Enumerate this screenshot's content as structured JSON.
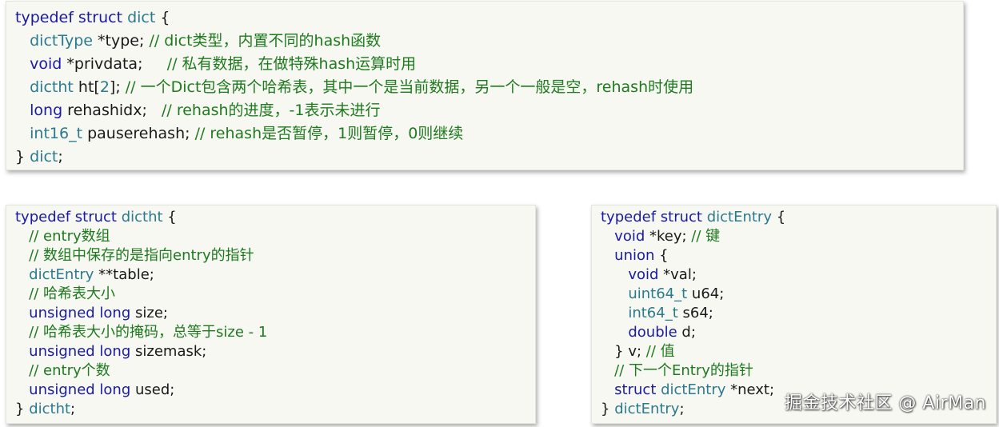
{
  "dict": {
    "lines": [
      [
        [
          "kw",
          "typedef struct "
        ],
        [
          "ty",
          "dict"
        ],
        [
          "id",
          " {"
        ]
      ],
      [
        [
          "id",
          "   "
        ],
        [
          "ty",
          "dictType"
        ],
        [
          "id",
          " *type; "
        ],
        [
          "cm",
          "// dict类型，内置不同的hash函数"
        ]
      ],
      [
        [
          "id",
          "   "
        ],
        [
          "kw",
          "void"
        ],
        [
          "id",
          " *privdata;     "
        ],
        [
          "cm",
          "// 私有数据，在做特殊hash运算时用"
        ]
      ],
      [
        [
          "id",
          "   "
        ],
        [
          "ty",
          "dictht"
        ],
        [
          "id",
          " ht["
        ],
        [
          "ty",
          "2"
        ],
        [
          "id",
          "]; "
        ],
        [
          "cm",
          "// 一个Dict包含两个哈希表，其中一个是当前数据，另一个一般是空，rehash时使用"
        ]
      ],
      [
        [
          "id",
          "   "
        ],
        [
          "kw",
          "long"
        ],
        [
          "id",
          " rehashidx;   "
        ],
        [
          "cm",
          "// rehash的进度，-1表示未进行"
        ]
      ],
      [
        [
          "id",
          "   "
        ],
        [
          "ty",
          "int16_t"
        ],
        [
          "id",
          " pauserehash; "
        ],
        [
          "cm",
          "// rehash是否暂停，1则暂停，0则继续"
        ]
      ],
      [
        [
          "id",
          "} "
        ],
        [
          "ty",
          "dict"
        ],
        [
          "id",
          ";"
        ]
      ]
    ]
  },
  "dictht": {
    "lines": [
      [
        [
          "kw",
          "typedef struct "
        ],
        [
          "ty",
          "dictht"
        ],
        [
          "id",
          " {"
        ]
      ],
      [
        [
          "id",
          "   "
        ],
        [
          "cm",
          "// entry数组"
        ]
      ],
      [
        [
          "id",
          "   "
        ],
        [
          "cm",
          "// 数组中保存的是指向entry的指针"
        ]
      ],
      [
        [
          "id",
          "   "
        ],
        [
          "ty",
          "dictEntry"
        ],
        [
          "id",
          " **table;"
        ]
      ],
      [
        [
          "id",
          "   "
        ],
        [
          "cm",
          "// 哈希表大小"
        ]
      ],
      [
        [
          "id",
          "   "
        ],
        [
          "kw",
          "unsigned long"
        ],
        [
          "id",
          " size;"
        ]
      ],
      [
        [
          "id",
          "   "
        ],
        [
          "cm",
          "// 哈希表大小的掩码，总等于size - 1"
        ]
      ],
      [
        [
          "id",
          "   "
        ],
        [
          "kw",
          "unsigned long"
        ],
        [
          "id",
          " sizemask;"
        ]
      ],
      [
        [
          "id",
          "   "
        ],
        [
          "cm",
          "// entry个数"
        ]
      ],
      [
        [
          "id",
          "   "
        ],
        [
          "kw",
          "unsigned long"
        ],
        [
          "id",
          " used;"
        ]
      ],
      [
        [
          "id",
          "} "
        ],
        [
          "ty",
          "dictht"
        ],
        [
          "id",
          ";"
        ]
      ]
    ]
  },
  "dictEntry": {
    "lines": [
      [
        [
          "kw",
          "typedef struct "
        ],
        [
          "ty",
          "dictEntry"
        ],
        [
          "id",
          " {"
        ]
      ],
      [
        [
          "id",
          "   "
        ],
        [
          "kw",
          "void"
        ],
        [
          "id",
          " *key; "
        ],
        [
          "cm",
          "// 键"
        ]
      ],
      [
        [
          "id",
          "   "
        ],
        [
          "kw",
          "union"
        ],
        [
          "id",
          " {"
        ]
      ],
      [
        [
          "id",
          "      "
        ],
        [
          "kw",
          "void"
        ],
        [
          "id",
          " *val;"
        ]
      ],
      [
        [
          "id",
          "      "
        ],
        [
          "ty",
          "uint64_t"
        ],
        [
          "id",
          " u64;"
        ]
      ],
      [
        [
          "id",
          "      "
        ],
        [
          "ty",
          "int64_t"
        ],
        [
          "id",
          " s64;"
        ]
      ],
      [
        [
          "id",
          "      "
        ],
        [
          "kw",
          "double"
        ],
        [
          "id",
          " d;"
        ]
      ],
      [
        [
          "id",
          "   } v; "
        ],
        [
          "cm",
          "// 值"
        ]
      ],
      [
        [
          "id",
          "   "
        ],
        [
          "cm",
          "// 下一个Entry的指针"
        ]
      ],
      [
        [
          "id",
          "   "
        ],
        [
          "kw",
          "struct "
        ],
        [
          "ty",
          "dictEntry"
        ],
        [
          "id",
          " *next;"
        ]
      ],
      [
        [
          "id",
          "} "
        ],
        [
          "ty",
          "dictEntry"
        ],
        [
          "id",
          ";"
        ]
      ]
    ]
  },
  "watermark": "掘金技术社区 @ AirMan"
}
